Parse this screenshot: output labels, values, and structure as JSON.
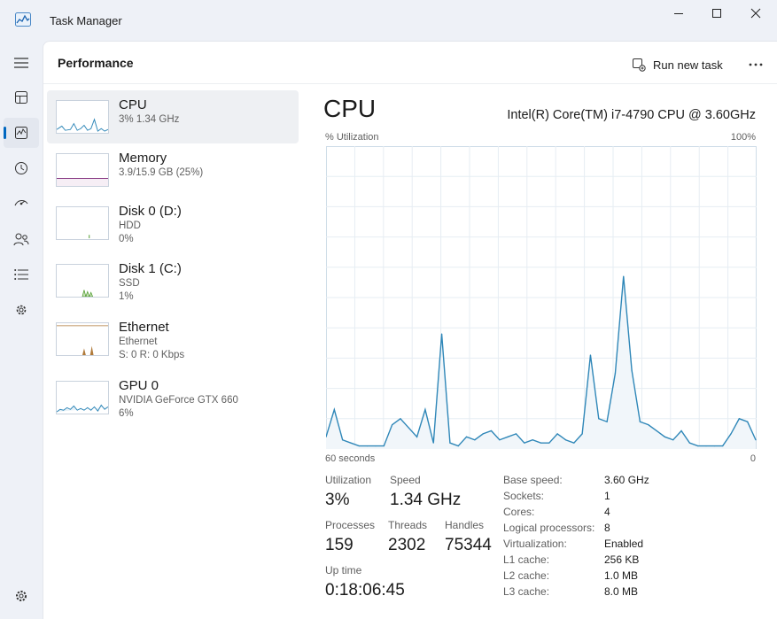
{
  "window": {
    "title": "Task Manager"
  },
  "nav": [
    {
      "name": "hamburger-menu-icon"
    },
    {
      "name": "processes-icon"
    },
    {
      "name": "performance-icon",
      "active": true
    },
    {
      "name": "app-history-icon"
    },
    {
      "name": "startup-apps-icon"
    },
    {
      "name": "users-icon"
    },
    {
      "name": "details-icon"
    },
    {
      "name": "services-icon"
    },
    {
      "name": "settings-icon"
    }
  ],
  "header": {
    "title": "Performance",
    "run_task": "Run new task"
  },
  "devices": [
    {
      "name": "CPU",
      "line1": "3%  1.34 GHz",
      "line2": ""
    },
    {
      "name": "Memory",
      "line1": "3.9/15.9 GB (25%)",
      "line2": ""
    },
    {
      "name": "Disk 0 (D:)",
      "line1": "HDD",
      "line2": "0%"
    },
    {
      "name": "Disk 1 (C:)",
      "line1": "SSD",
      "line2": "1%"
    },
    {
      "name": "Ethernet",
      "line1": "Ethernet",
      "line2": "S: 0  R: 0 Kbps"
    },
    {
      "name": "GPU 0",
      "line1": "NVIDIA GeForce GTX 660",
      "line2": "6%"
    }
  ],
  "detail": {
    "title": "CPU",
    "model": "Intel(R) Core(TM) i7-4790 CPU @ 3.60GHz",
    "graph_label": "% Utilization",
    "graph_max": "100%",
    "graph_span": "60 seconds",
    "graph_min": "0",
    "stats": {
      "utilization": {
        "label": "Utilization",
        "value": "3%"
      },
      "speed": {
        "label": "Speed",
        "value": "1.34 GHz"
      },
      "processes": {
        "label": "Processes",
        "value": "159"
      },
      "threads": {
        "label": "Threads",
        "value": "2302"
      },
      "handles": {
        "label": "Handles",
        "value": "75344"
      },
      "uptime": {
        "label": "Up time",
        "value": "0:18:06:45"
      }
    },
    "specs": [
      {
        "key": "Base speed:",
        "value": "3.60 GHz"
      },
      {
        "key": "Sockets:",
        "value": "1"
      },
      {
        "key": "Cores:",
        "value": "4"
      },
      {
        "key": "Logical processors:",
        "value": "8"
      },
      {
        "key": "Virtualization:",
        "value": "Enabled"
      },
      {
        "key": "L1 cache:",
        "value": "256 KB"
      },
      {
        "key": "L2 cache:",
        "value": "1.0 MB"
      },
      {
        "key": "L3 cache:",
        "value": "8.0 MB"
      }
    ]
  },
  "chart_data": {
    "type": "area",
    "ylim": [
      0,
      100
    ],
    "series": [
      {
        "values": [
          4,
          13,
          3,
          2,
          1,
          1,
          1,
          1,
          8,
          10,
          7,
          4,
          13,
          2,
          38,
          2,
          1,
          4,
          3,
          5,
          6,
          3,
          4,
          5,
          2,
          3,
          2,
          2,
          5,
          3,
          2,
          5,
          31,
          10,
          9,
          25,
          57,
          26,
          9,
          8,
          6,
          4,
          3,
          6,
          2,
          1,
          1,
          1,
          1,
          5,
          10,
          9,
          3
        ]
      }
    ],
    "color": "#2f87b8",
    "fill": "#f1f6fa"
  }
}
